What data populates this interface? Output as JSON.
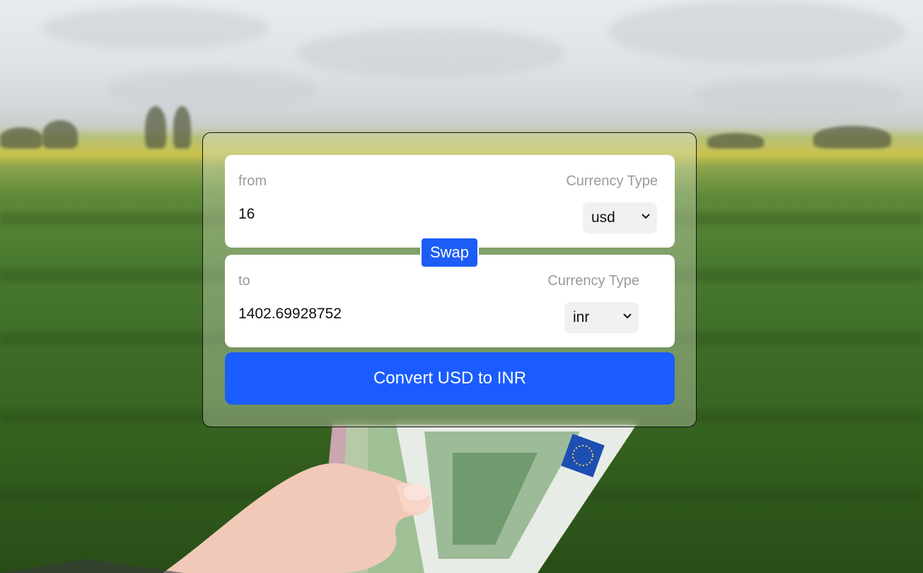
{
  "converter": {
    "from": {
      "label": "from",
      "currency_type_label": "Currency Type",
      "amount": "16",
      "currency": "usd"
    },
    "to": {
      "label": "to",
      "currency_type_label": "Currency Type",
      "amount": "1402.69928752",
      "currency": "inr"
    },
    "swap_label": "Swap",
    "convert_label": "Convert USD to INR"
  },
  "colors": {
    "accent": "#1a5cff",
    "panel": "#ffffff",
    "label_gray": "#9a9a9a"
  },
  "icons": {
    "select_arrow": "chevron-down-icon"
  }
}
